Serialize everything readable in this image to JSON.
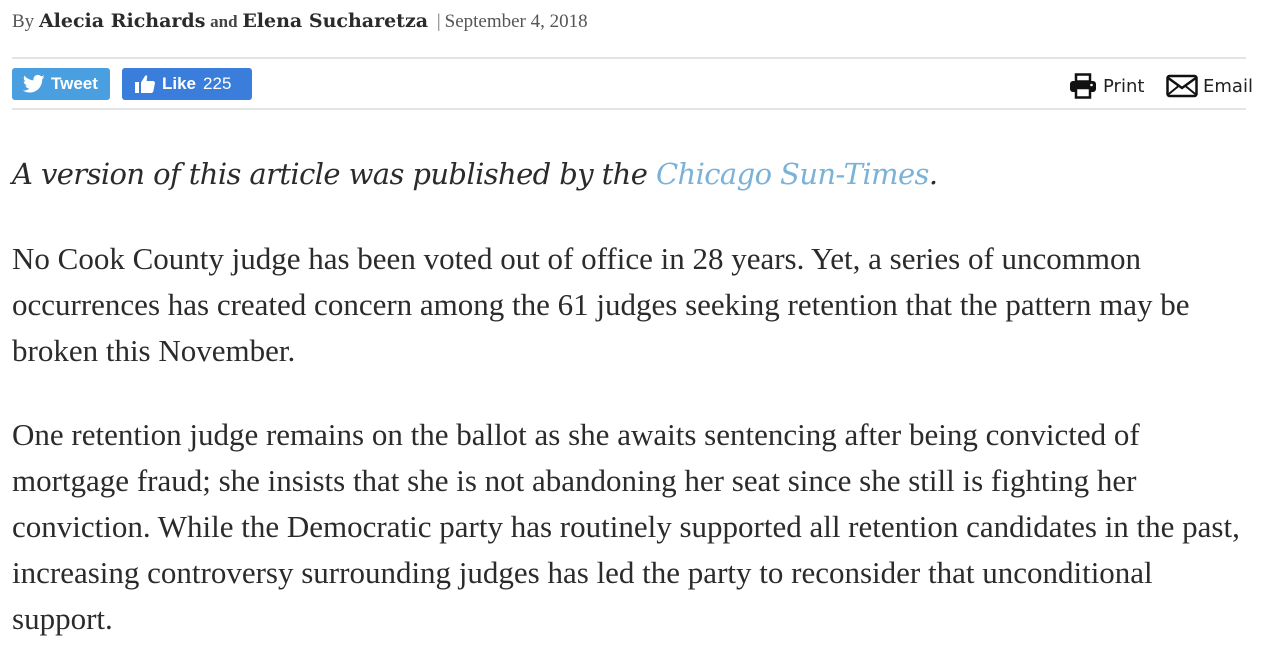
{
  "byline": {
    "by": "By",
    "author1": "Alecia Richards",
    "and": "and",
    "author2": "Elena Sucharetza",
    "separator": "|",
    "date": "September 4, 2018"
  },
  "share": {
    "tweet_label": "Tweet",
    "like_label": "Like",
    "like_count": "225",
    "print_label": "Print",
    "email_label": "Email"
  },
  "colors": {
    "tweet_button": "#4a9fe0",
    "like_button": "#3b7ddb",
    "link": "#7ab2d8"
  },
  "article": {
    "lede_prefix": "A version of this article was published by the ",
    "lede_link": "Chicago Sun-Times",
    "lede_suffix": ".",
    "paragraphs": [
      "No Cook County judge has been voted out of office in 28 years. Yet, a series of uncommon occurrences has created concern among the 61 judges seeking retention that the pattern may be broken this November.",
      "One retention judge remains on the ballot as she awaits sentencing after being convicted of mortgage fraud; she insists that she is not abandoning her seat since she still is fighting her conviction. While the Democratic party has routinely supported all retention candidates in the past, increasing controversy surrounding judges has led the party to reconsider that unconditional support."
    ]
  }
}
